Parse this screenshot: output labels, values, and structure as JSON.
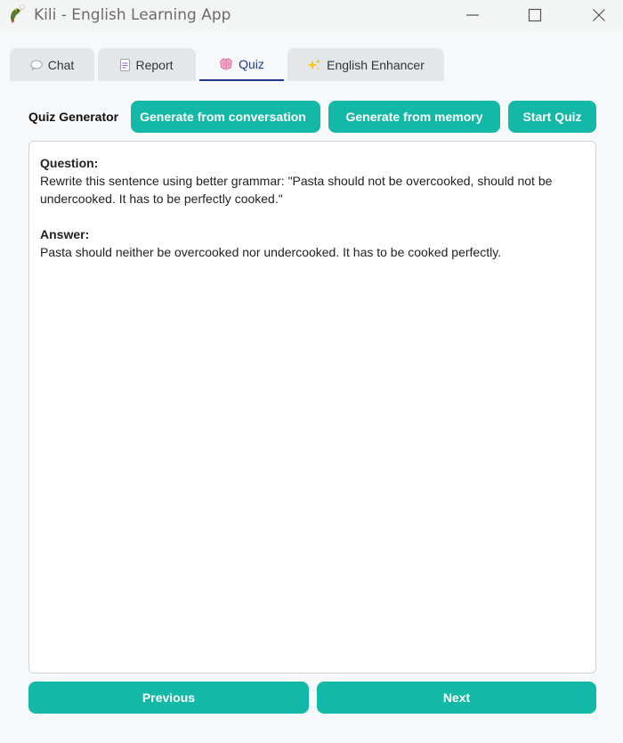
{
  "window": {
    "title": "Kili - English Learning App"
  },
  "tabs": [
    {
      "label": "Chat",
      "icon": "speech-bubble-icon",
      "active": false
    },
    {
      "label": "Report",
      "icon": "document-icon",
      "active": false
    },
    {
      "label": "Quiz",
      "icon": "brain-icon",
      "active": true
    },
    {
      "label": "English Enhancer",
      "icon": "sparkles-icon",
      "active": false
    }
  ],
  "toolbar": {
    "label": "Quiz Generator",
    "generate_conversation": "Generate from conversation",
    "generate_memory": "Generate from memory",
    "start_quiz": "Start Quiz"
  },
  "quiz": {
    "question_label": "Question:",
    "question_text": "Rewrite this sentence using better grammar: \"Pasta should not be overcooked, should not be undercooked. It has to be perfectly cooked.\"",
    "answer_label": "Answer:",
    "answer_text": "Pasta should neither be overcooked nor undercooked. It has to be cooked perfectly."
  },
  "nav": {
    "previous": "Previous",
    "next": "Next"
  },
  "colors": {
    "accent": "#14b8a6",
    "active_tab_text": "#1f3a8a",
    "tab_bg": "#e4e7ea",
    "page_bg": "#f7f8fa"
  }
}
